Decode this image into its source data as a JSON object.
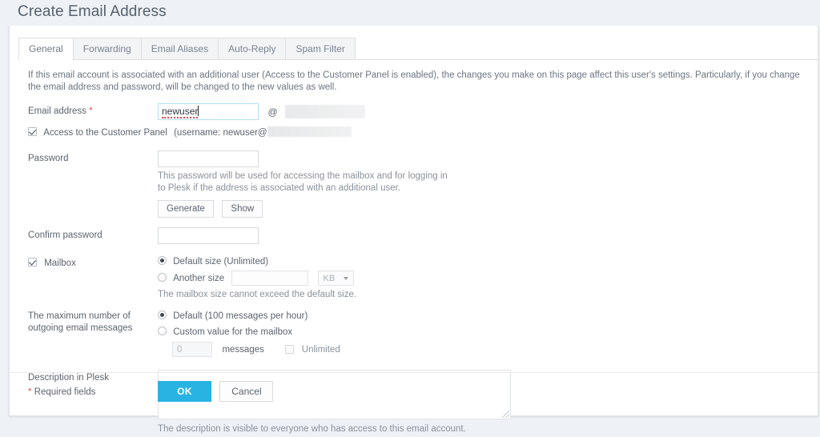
{
  "page": {
    "title": "Create Email Address",
    "background_color": "#eef1f5",
    "accent_color": "#28b3e3"
  },
  "tabs": [
    {
      "label": "General",
      "active": true
    },
    {
      "label": "Forwarding",
      "active": false
    },
    {
      "label": "Email Aliases",
      "active": false
    },
    {
      "label": "Auto-Reply",
      "active": false
    },
    {
      "label": "Spam Filter",
      "active": false
    }
  ],
  "intro_text": "If this email account is associated with an additional user (Access to the Customer Panel is enabled), the changes you make on this page affect this user's settings. Particularly, if you change the email address and password, will be changed to the new values as well.",
  "form": {
    "email": {
      "label": "Email address",
      "required_mark": "*",
      "value": "newuser",
      "at_symbol": "@",
      "domain_redacted": true
    },
    "customer_panel": {
      "label": "Access to the Customer Panel",
      "username_prefix": "(username: newuser@",
      "checked": true
    },
    "password": {
      "label": "Password",
      "value": "",
      "hint": "This password will be used for accessing the mailbox and for logging in to Plesk if the address is associated with an additional user.",
      "generate_label": "Generate",
      "show_label": "Show"
    },
    "confirm_password": {
      "label": "Confirm password",
      "value": ""
    },
    "mailbox": {
      "label": "Mailbox",
      "checked": true,
      "options": [
        {
          "label": "Default size (Unlimited)",
          "selected": true
        },
        {
          "label": "Another size",
          "selected": false
        }
      ],
      "size_value": "",
      "unit_value": "KB",
      "hint": "The mailbox size cannot exceed the default size."
    },
    "outgoing": {
      "label": "The maximum number of outgoing email messages",
      "options": [
        {
          "label": "Default (100 messages per hour)",
          "selected": true
        },
        {
          "label": "Custom value for the mailbox",
          "selected": false
        }
      ],
      "messages_placeholder": "0",
      "messages_unit": "messages",
      "unlimited_label": "Unlimited",
      "unlimited_checked": false
    },
    "description": {
      "label": "Description in Plesk",
      "value": "",
      "hint": "The description is visible to everyone who has access to this email account."
    }
  },
  "footer": {
    "required_mark": "*",
    "required_text": "Required fields",
    "ok_label": "OK",
    "cancel_label": "Cancel"
  }
}
